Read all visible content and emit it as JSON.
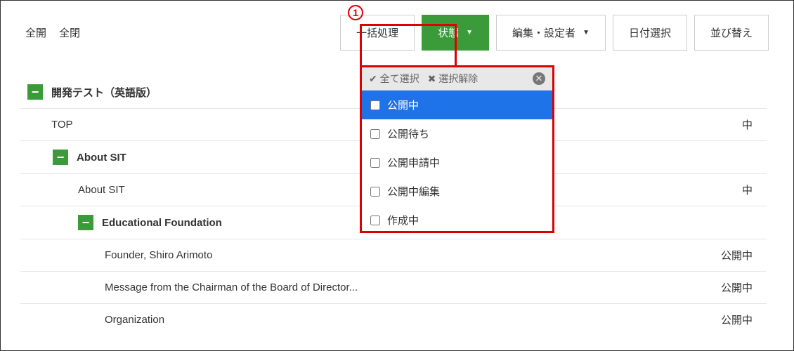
{
  "annotation": {
    "label": "1"
  },
  "toolbar": {
    "expand_all": "全開",
    "collapse_all": "全閉",
    "batch": "一括処理",
    "status": "状態",
    "editor": "編集・設定者",
    "date": "日付選択",
    "sort": "並び替え"
  },
  "dropdown": {
    "select_all": "全て選択",
    "deselect": "選択解除",
    "items": [
      {
        "label": "公開中",
        "highlight": true
      },
      {
        "label": "公開待ち",
        "highlight": false
      },
      {
        "label": "公開申請中",
        "highlight": false
      },
      {
        "label": "公開中編集",
        "highlight": false
      },
      {
        "label": "作成中",
        "highlight": false
      }
    ]
  },
  "tree": {
    "rows": [
      {
        "indent": "ind-0",
        "toggle": true,
        "bold": true,
        "label": "開発テスト（英語版）",
        "status": ""
      },
      {
        "indent": "ind-1",
        "toggle": false,
        "bold": false,
        "label": "TOP",
        "status": "中"
      },
      {
        "indent": "ind-2",
        "toggle": true,
        "bold": true,
        "label": "About SIT",
        "status": ""
      },
      {
        "indent": "ind-3",
        "toggle": false,
        "bold": false,
        "label": "About SIT",
        "status": "中"
      },
      {
        "indent": "ind-4",
        "toggle": true,
        "bold": true,
        "label": "Educational Foundation",
        "status": ""
      },
      {
        "indent": "ind-5",
        "toggle": false,
        "bold": false,
        "label": "Founder, Shiro Arimoto",
        "status": "公開中"
      },
      {
        "indent": "ind-5",
        "toggle": false,
        "bold": false,
        "label": "Message from the Chairman of the Board of Director...",
        "status": "公開中"
      },
      {
        "indent": "ind-5",
        "toggle": false,
        "bold": false,
        "label": "Organization",
        "status": "公開中"
      }
    ]
  }
}
